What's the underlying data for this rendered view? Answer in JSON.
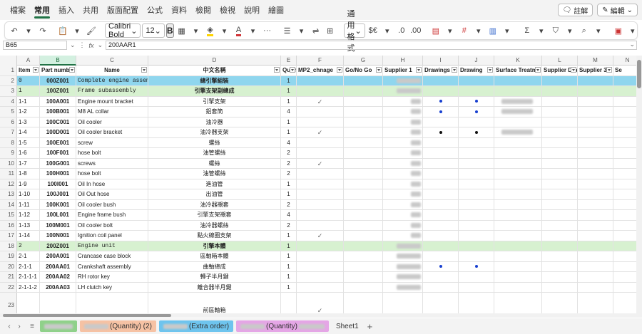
{
  "menu": {
    "tabs": [
      "檔案",
      "常用",
      "插入",
      "共用",
      "版面配置",
      "公式",
      "資料",
      "檢閱",
      "檢視",
      "說明",
      "繪圖"
    ],
    "active": "常用",
    "comment_label": "註解",
    "editing_label": "編輯"
  },
  "ribbon": {
    "font_name": "Calibri Bold",
    "font_size": "12",
    "bold_label": "B",
    "number_format": "通用格式",
    "currency_symbol": "$€",
    "font_color": "#d13438",
    "fill_color": "#ffd400"
  },
  "formula_bar": {
    "name_box": "B65",
    "fx_label": "fx",
    "content": "200AAR1"
  },
  "columns": [
    {
      "letter": "A",
      "selected": false
    },
    {
      "letter": "B",
      "selected": true
    },
    {
      "letter": "C",
      "selected": false
    },
    {
      "letter": "D",
      "selected": false
    },
    {
      "letter": "E",
      "selected": false
    },
    {
      "letter": "F",
      "selected": false
    },
    {
      "letter": "G",
      "selected": false
    },
    {
      "letter": "H",
      "selected": false
    },
    {
      "letter": "I",
      "selected": false
    },
    {
      "letter": "J",
      "selected": false
    },
    {
      "letter": "K",
      "selected": false
    },
    {
      "letter": "L",
      "selected": false
    },
    {
      "letter": "M",
      "selected": false
    },
    {
      "letter": "N",
      "selected": false
    }
  ],
  "header_row": {
    "num": "1",
    "cells": [
      "Item",
      "Part numb",
      "Name",
      "中文名稱",
      "Quant",
      "MP2_chnage",
      "Go/No Go",
      "Supplier 1",
      "Drawings",
      "Drawing",
      "Surface Treatm",
      "Supplier Drav",
      "Supplier 3D",
      "Se"
    ]
  },
  "rows": [
    {
      "num": "2",
      "style": "blue",
      "item": "0",
      "part": "000Z001",
      "name": "Complete engine assembly",
      "mono": true,
      "cn": "總引擎組裝",
      "cn_bold": true,
      "qty": "1",
      "mp2": "",
      "supplier": "blur",
      "drawings": "",
      "drawing": "",
      "surface": ""
    },
    {
      "num": "3",
      "style": "green",
      "item": "1",
      "part": "100Z001",
      "name": "Frame subassembly",
      "mono": true,
      "cn": "引擎支架副總成",
      "cn_bold": true,
      "qty": "1",
      "mp2": "",
      "supplier": "blur",
      "drawings": "",
      "drawing": "",
      "surface": ""
    },
    {
      "num": "4",
      "style": "",
      "item": "1-1",
      "part": "100A001",
      "name": "Engine mount bracket",
      "mono": false,
      "cn": "引擎支架",
      "cn_bold": false,
      "qty": "1",
      "mp2": "✓",
      "supplier": "blur-s",
      "drawings": "blue",
      "drawing": "blue",
      "surface": "blur"
    },
    {
      "num": "5",
      "style": "",
      "item": "1-2",
      "part": "100B001",
      "name": "M8 AL collar",
      "mono": false,
      "cn": "鋁套筒",
      "cn_bold": false,
      "qty": "4",
      "mp2": "",
      "supplier": "blur-s",
      "drawings": "blue",
      "drawing": "blue",
      "surface": "blur"
    },
    {
      "num": "6",
      "style": "",
      "item": "1-3",
      "part": "100C001",
      "name": "Oil cooler",
      "mono": false,
      "cn": "油冷器",
      "cn_bold": false,
      "qty": "1",
      "mp2": "",
      "supplier": "blur-s",
      "drawings": "",
      "drawing": "",
      "surface": ""
    },
    {
      "num": "7",
      "style": "",
      "item": "1-4",
      "part": "100D001",
      "name": "Oil cooler bracket",
      "mono": false,
      "cn": "油冷器支架",
      "cn_bold": false,
      "qty": "1",
      "mp2": "✓",
      "supplier": "blur-s",
      "drawings": "black",
      "drawing": "black",
      "surface": "blur"
    },
    {
      "num": "8",
      "style": "",
      "item": "1-5",
      "part": "100E001",
      "name": "screw",
      "mono": false,
      "cn": "螺絲",
      "cn_bold": false,
      "qty": "4",
      "mp2": "",
      "supplier": "blur-s",
      "drawings": "",
      "drawing": "",
      "surface": ""
    },
    {
      "num": "9",
      "style": "",
      "item": "1-6",
      "part": "100F001",
      "name": "hose bolt",
      "mono": false,
      "cn": "油管螺絲",
      "cn_bold": false,
      "qty": "2",
      "mp2": "",
      "supplier": "blur-s",
      "drawings": "",
      "drawing": "",
      "surface": ""
    },
    {
      "num": "10",
      "style": "",
      "item": "1-7",
      "part": "100G001",
      "name": "screws",
      "mono": false,
      "cn": "螺絲",
      "cn_bold": false,
      "qty": "2",
      "mp2": "✓",
      "supplier": "blur-s",
      "drawings": "",
      "drawing": "",
      "surface": ""
    },
    {
      "num": "11",
      "style": "",
      "item": "1-8",
      "part": "100H001",
      "name": "hose bolt",
      "mono": false,
      "cn": "油管螺絲",
      "cn_bold": false,
      "qty": "2",
      "mp2": "",
      "supplier": "blur-s",
      "drawings": "",
      "drawing": "",
      "surface": ""
    },
    {
      "num": "12",
      "style": "",
      "item": "1-9",
      "part": "100I001",
      "name": "Oil In hose",
      "mono": false,
      "cn": "進油管",
      "cn_bold": false,
      "qty": "1",
      "mp2": "",
      "supplier": "blur-s",
      "drawings": "",
      "drawing": "",
      "surface": ""
    },
    {
      "num": "13",
      "style": "",
      "item": "1-10",
      "part": "100J001",
      "name": "Oil Out hose",
      "mono": false,
      "cn": "出油管",
      "cn_bold": false,
      "qty": "1",
      "mp2": "",
      "supplier": "blur-s",
      "drawings": "",
      "drawing": "",
      "surface": ""
    },
    {
      "num": "14",
      "style": "",
      "item": "1-11",
      "part": "100K001",
      "name": "Oil cooler bush",
      "mono": false,
      "cn": "油冷器襯套",
      "cn_bold": false,
      "qty": "2",
      "mp2": "",
      "supplier": "blur-s",
      "drawings": "",
      "drawing": "",
      "surface": ""
    },
    {
      "num": "15",
      "style": "",
      "item": "1-12",
      "part": "100L001",
      "name": "Engine frame bush",
      "mono": false,
      "cn": "引擎支架襯套",
      "cn_bold": false,
      "qty": "4",
      "mp2": "",
      "supplier": "blur-s",
      "drawings": "",
      "drawing": "",
      "surface": ""
    },
    {
      "num": "16",
      "style": "",
      "item": "1-13",
      "part": "100M001",
      "name": "Oil cooler bolt",
      "mono": false,
      "cn": "油冷器螺絲",
      "cn_bold": false,
      "qty": "2",
      "mp2": "",
      "supplier": "blur-s",
      "drawings": "",
      "drawing": "",
      "surface": ""
    },
    {
      "num": "17",
      "style": "",
      "item": "1-14",
      "part": "100N001",
      "name": "Ignition coil panel",
      "mono": false,
      "cn": "點火線圈支架",
      "cn_bold": false,
      "qty": "1",
      "mp2": "✓",
      "supplier": "blur-s",
      "drawings": "",
      "drawing": "",
      "surface": ""
    },
    {
      "num": "18",
      "style": "green",
      "item": "2",
      "part": "200Z001",
      "name": "Engine unit",
      "mono": true,
      "cn": "引擎本體",
      "cn_bold": true,
      "qty": "1",
      "mp2": "",
      "supplier": "blur",
      "drawings": "",
      "drawing": "",
      "surface": ""
    },
    {
      "num": "19",
      "style": "",
      "item": "2-1",
      "part": "200A001",
      "name": "Crancase case block",
      "mono": false,
      "cn": "區軸箱本體",
      "cn_bold": false,
      "qty": "1",
      "mp2": "",
      "supplier": "blur",
      "drawings": "",
      "drawing": "",
      "surface": ""
    },
    {
      "num": "20",
      "style": "",
      "item": "2-1-1",
      "part": "200AA01",
      "name": "Crankshaft assembly",
      "mono": false,
      "cn": "曲軸總成",
      "cn_bold": false,
      "qty": "1",
      "mp2": "",
      "supplier": "blur",
      "drawings": "blue",
      "drawing": "blue",
      "surface": ""
    },
    {
      "num": "21",
      "style": "",
      "item": "2-1-1-1",
      "part": "200AA02",
      "name": "RH rotor key",
      "mono": false,
      "cn": "轉子半月鍵",
      "cn_bold": false,
      "qty": "1",
      "mp2": "",
      "supplier": "blur",
      "drawings": "",
      "drawing": "",
      "surface": ""
    },
    {
      "num": "22",
      "style": "",
      "item": "2-1-1-2",
      "part": "200AA03",
      "name": "LH clutch key",
      "mono": false,
      "cn": "離合器半月鍵",
      "cn_bold": false,
      "qty": "1",
      "mp2": "",
      "supplier": "blur",
      "drawings": "",
      "drawing": "",
      "surface": ""
    }
  ],
  "tall_row": {
    "num": "23",
    "cn": "前區軸箱",
    "mp2": "✓"
  },
  "sheet_tabs": [
    {
      "label": "",
      "blurred": true,
      "color": "#8fd18a"
    },
    {
      "label": "(Quantity) (2)",
      "blurred": true,
      "color": "#f6c2a4"
    },
    {
      "label": "(Extra order)",
      "blurred": true,
      "color": "#6ec4ee"
    },
    {
      "label": "(Quantity)",
      "blurred": true,
      "color": "#e5a6e6"
    },
    {
      "label": "Sheet1",
      "blurred": false,
      "color": ""
    }
  ]
}
